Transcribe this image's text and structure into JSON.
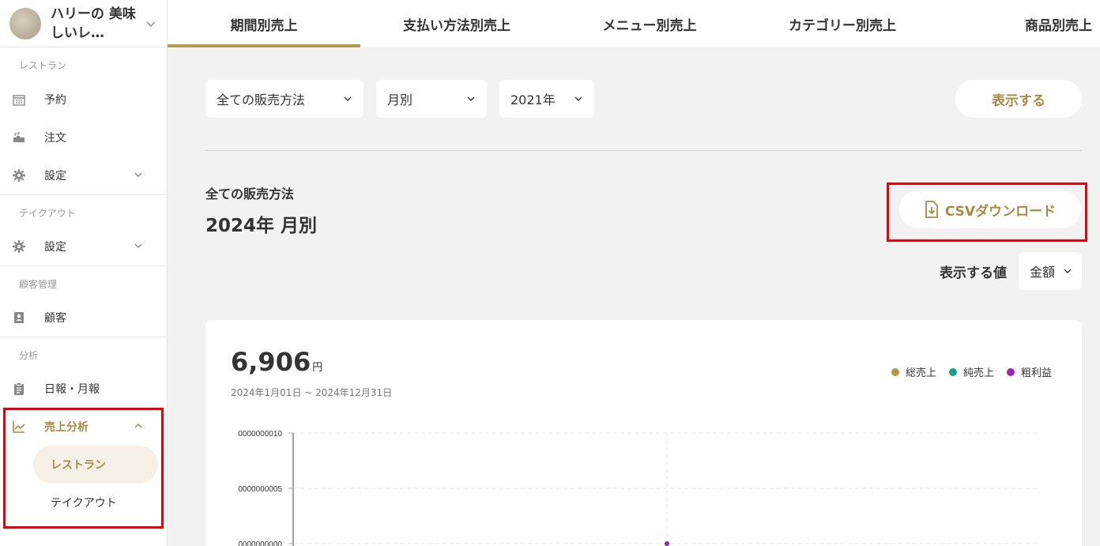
{
  "store": {
    "name": "ハリーの 美味しいレ…"
  },
  "sidebar": {
    "sections": [
      {
        "label": "レストラン"
      },
      {
        "label": "テイクアウト"
      },
      {
        "label": "顧客管理"
      },
      {
        "label": "分析"
      }
    ],
    "items": {
      "reservation": "予約",
      "order": "注文",
      "settings_restaurant": "設定",
      "settings_takeout": "設定",
      "customers": "顧客",
      "daily_monthly": "日報・月報",
      "sales_analysis": "売上分析",
      "sub_restaurant": "レストラン",
      "sub_takeout": "テイクアウト"
    }
  },
  "tabs": [
    "期間別売上",
    "支払い方法別売上",
    "メニュー別売上",
    "カテゴリー別売上",
    "商品別売上"
  ],
  "filters": {
    "sales_method": "全ての販売方法",
    "period": "月別",
    "year": "2021年",
    "show_button": "表示する"
  },
  "summary": {
    "title": "全ての販売方法",
    "subtitle": "2024年 月別",
    "csv_button": "CSVダウンロード",
    "value_label": "表示する値",
    "value_select": "金額"
  },
  "chart_card": {
    "total": "6,906",
    "unit": "円",
    "range": "2024年1月01日 ~ 2024年12月31日",
    "legend": [
      {
        "name": "総売上",
        "color": "#b5964e"
      },
      {
        "name": "純売上",
        "color": "#16a085"
      },
      {
        "name": "粗利益",
        "color": "#9b27b0"
      }
    ]
  },
  "chart_data": {
    "type": "line",
    "yticks": [
      "0000000010",
      "0000000005",
      "0000000000"
    ],
    "ylim": [
      0,
      10
    ],
    "series": [
      {
        "name": "総売上",
        "values": [
          0
        ]
      },
      {
        "name": "純売上",
        "values": [
          0
        ]
      },
      {
        "name": "粗利益",
        "values": [
          0
        ]
      }
    ]
  }
}
